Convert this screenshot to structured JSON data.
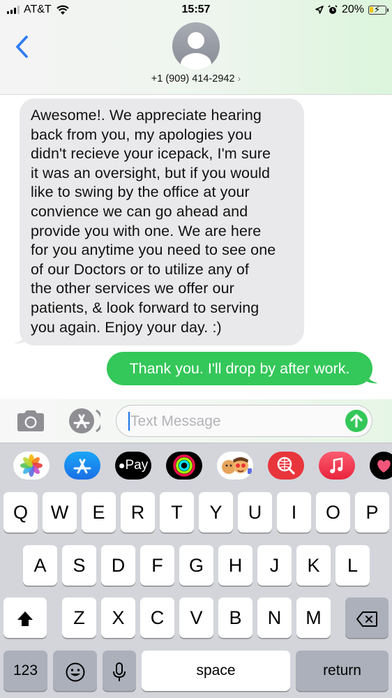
{
  "status_bar": {
    "carrier": "AT&T",
    "time": "15:57",
    "battery": "20%"
  },
  "header": {
    "contact_number": "+1 (909) 414-2942",
    "contact_chevron": "›"
  },
  "messages": [
    {
      "direction": "incoming",
      "lines": [
        "Awesome!. We appreciate hearing",
        "back from you, my apologies you",
        "didn't recieve your icepack, I'm sure",
        "it was an oversight, but if you would",
        "like to swing by the office at your",
        "convience we can go ahead and",
        "provide you with one. We are here",
        "for you anytime you need to see one",
        "of our Doctors or to utilize any of",
        "the other services we offer our",
        "patients, & look forward to serving",
        "you again. Enjoy your day. :)"
      ]
    },
    {
      "direction": "outgoing",
      "text": "Thank you. I'll drop by after work."
    }
  ],
  "input": {
    "placeholder": "Text Message"
  },
  "app_strip": {
    "apple_pay_label": "Pay",
    "apps": [
      "photos-icon",
      "app-store-icon",
      "apple-pay-icon",
      "activity-icon",
      "memoji-icon",
      "web-search-icon",
      "music-icon",
      "digital-touch-icon"
    ]
  },
  "keyboard": {
    "row1": [
      "Q",
      "W",
      "E",
      "R",
      "T",
      "Y",
      "U",
      "I",
      "O",
      "P"
    ],
    "row2": [
      "A",
      "S",
      "D",
      "F",
      "G",
      "H",
      "J",
      "K",
      "L"
    ],
    "row3": [
      "Z",
      "X",
      "C",
      "V",
      "B",
      "N",
      "M"
    ],
    "numbers_label": "123",
    "space_label": "space",
    "return_label": "return"
  },
  "colors": {
    "imessage_green": "#34c759",
    "incoming_bubble": "#e9e9eb",
    "ios_blue": "#2f7cf6"
  }
}
